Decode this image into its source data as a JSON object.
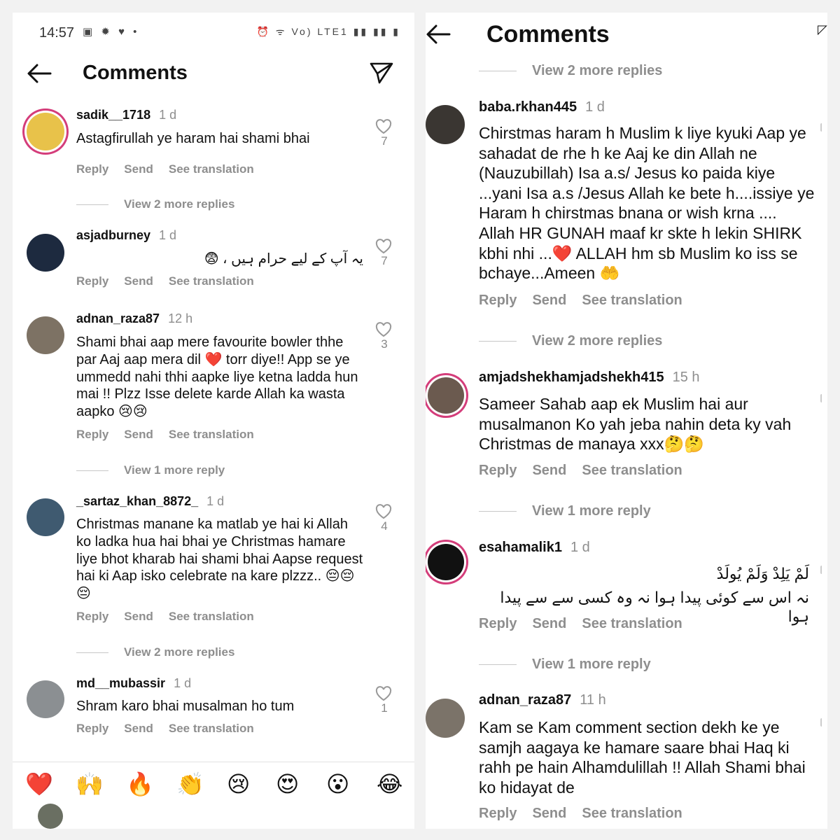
{
  "left": {
    "status": {
      "time": "14:57",
      "left_icons": "▣ ✹ ♥ •",
      "right_icons": "⏰ ᯤ Vo) LTE1 ▮▮ ▮▮ ▮"
    },
    "header": {
      "title": "Comments"
    },
    "comments": [
      {
        "user": "sadik__1718",
        "time": "1 d",
        "text": "Astagfirullah ye haram hai shami bhai",
        "likes": "7",
        "reply": "Reply",
        "send": "Send",
        "translate": "See translation"
      },
      {
        "user": "asjadburney",
        "time": "1 d",
        "text": "یہ آپ کے لیے حرام ہیں ، 😨",
        "likes": "7",
        "reply": "Reply",
        "send": "Send",
        "translate": "See translation"
      },
      {
        "user": "adnan_raza87",
        "time": "12 h",
        "text": "Shami bhai aap mere favourite bowler thhe par Aaj aap mera dil ❤️ torr diye!! App se ye ummedd nahi thhi aapke liye ketna ladda hun mai !! Plzz Isse delete karde Allah ka wasta aapko 😢😢",
        "likes": "3",
        "reply": "Reply",
        "send": "Send",
        "translate": "See translation"
      },
      {
        "user": "_sartaz_khan_8872_",
        "time": "1 d",
        "text": "Christmas manane ka matlab ye hai ki Allah ko ladka hua hai bhai ye Christmas hamare liye bhot kharab hai shami bhai Aapse request hai ki Aap isko celebrate na kare plzzz.. 😔😔😔",
        "likes": "4",
        "reply": "Reply",
        "send": "Send",
        "translate": "See translation"
      },
      {
        "user": "md__mubassir",
        "time": "1 d",
        "text": "Shram karo bhai musalman ho tum",
        "likes": "1",
        "reply": "Reply",
        "send": "Send",
        "translate": "See translation"
      }
    ],
    "view_more": [
      "View 2 more replies",
      "View 1 more reply",
      "View 2 more replies"
    ],
    "emoji_bar": [
      "❤️",
      "🙌",
      "🔥",
      "👏",
      "😢",
      "😍",
      "😮",
      "😂"
    ]
  },
  "right": {
    "header": {
      "title": "Comments"
    },
    "view_more": [
      "View 2 more replies",
      "View 2 more replies",
      "View 1 more reply",
      "View 1 more reply"
    ],
    "comments": [
      {
        "user": "baba.rkhan445",
        "time": "1 d",
        "text": "Chirstmas haram h Muslim k liye kyuki Aap ye sahadat de rhe h ke Aaj ke din Allah ne (Nauzubillah) Isa a.s/ Jesus ko paida kiye ...yani Isa a.s /Jesus Allah ke bete h....issiye ye Haram h  chirstmas bnana or wish krna .... Allah HR GUNAH maaf kr skte h lekin SHIRK kbhi nhi ...❤️ ALLAH hm sb Muslim ko iss se bchaye...Ameen 🤲",
        "reply": "Reply",
        "send": "Send",
        "translate": "See translation"
      },
      {
        "user": "amjadshekhamjadshekh415",
        "time": "15 h",
        "text": "Sameer Sahab aap ek Muslim hai aur musalmanon Ko yah jeba nahin deta ky vah Christmas de manaya  xxx🤔🤔",
        "reply": "Reply",
        "send": "Send",
        "translate": "See translation"
      },
      {
        "user": "esahamalik1",
        "time": "1 d",
        "text_line1": "لَمْ يَلِدْ وَلَمْ يُولَدْ",
        "text_line2": "نہ اس سے کوئی پیدا ہوا نہ وہ کسی سے سے پیدا ہوا",
        "reply": "Reply",
        "send": "Send",
        "translate": "See translation"
      },
      {
        "user": "adnan_raza87",
        "time": "11 h",
        "text": "Kam se Kam comment section dekh ke ye samjh aagaya ke hamare saare bhai Haq ki rahh pe hain Alhamdulillah !! Allah Shami bhai ko hidayat de",
        "reply": "Reply",
        "send": "Send",
        "translate": "See translation"
      }
    ]
  }
}
